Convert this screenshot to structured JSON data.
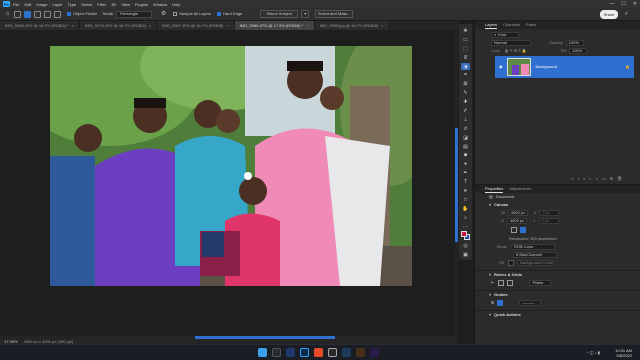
{
  "menubar": {
    "app_logo": "Ps",
    "items": [
      "File",
      "Edit",
      "Image",
      "Layer",
      "Type",
      "Select",
      "Filter",
      "3D",
      "View",
      "Plugins",
      "Window",
      "Help"
    ]
  },
  "window_controls": [
    "—",
    "☐",
    "✕"
  ],
  "options_bar": {
    "object_finder": "Object Finder",
    "mode_label": "Mode:",
    "mode_value": "Rectangle",
    "sample_all_layers": "Sample All Layers",
    "hard_edge": "Hard Edge",
    "select_subject": "Select Subject",
    "select_and_mask": "Select and Mask...",
    "share": "Share"
  },
  "tabs": [
    {
      "label": "IMG_9986.JPG @ 16.7% (RGB/8) *",
      "active": false
    },
    {
      "label": "IMG_9976.JPG @ 16.7% (RGB/8)",
      "active": false
    },
    {
      "label": "IMG_9987.JPG @ 16.7% (RGB/8)",
      "active": false
    },
    {
      "label": "IMG_9989.JPG @ 17.9% (RGB/8) *",
      "active": true
    },
    {
      "label": "IMG_9998.jpg @ 16.7% (RGB/8)",
      "active": false
    }
  ],
  "tools": [
    "move-tool",
    "artboard-tool",
    "marquee-tool",
    "lasso-tool",
    "object-selection-tool",
    "crop-tool",
    "frame-tool",
    "eyedropper-tool",
    "healing-tool",
    "brush-tool",
    "clone-stamp-tool",
    "history-brush-tool",
    "eraser-tool",
    "gradient-tool",
    "blur-tool",
    "dodge-tool",
    "pen-tool",
    "type-tool",
    "path-selection-tool",
    "rectangle-tool",
    "hand-tool",
    "zoom-tool",
    "more-tools",
    "color-swatches",
    "quick-mask",
    "screen-mode"
  ],
  "status": {
    "zoom": "17.99%",
    "dimensions": "4000 px x 4000 px (300 ppi)"
  },
  "layers_panel": {
    "tabs": [
      "Layers",
      "Channels",
      "Paths"
    ],
    "kind_label": "Kind",
    "blend_mode": "Normal",
    "opacity_label": "Opacity:",
    "opacity_value": "100%",
    "lock_label": "Lock:",
    "fill_label": "Fill:",
    "fill_value": "100%",
    "layer_name": "Background"
  },
  "properties_panel": {
    "tabs": [
      "Properties",
      "Adjustments"
    ],
    "doc_label": "Document",
    "canvas_header": "Canvas",
    "w_label": "W",
    "w_value": "4000 px",
    "h_label": "H",
    "h_value": "4000 px",
    "x_label": "X",
    "x_value": "0 px",
    "y_label": "Y",
    "y_value": "0 px",
    "resolution": "Resolution: 300 pixels/inch",
    "mode_label": "Mode",
    "mode_value": "RGB Color",
    "bitdepth_value": "8 Bits/Channel",
    "fill_label": "Fill",
    "fill_value": "Background Color",
    "rulers_header": "Rulers & Grids",
    "pixels_value": "Pixels",
    "guides_header": "Guides",
    "quick_actions_header": "Quick Actions"
  },
  "taskbar": {
    "time": "10:31 AM",
    "date": "9/8/2022"
  },
  "colors": {
    "accent": "#2f6fcf",
    "foreground_swatch": "#c8143c",
    "background_swatch": "#1a4c9c"
  }
}
